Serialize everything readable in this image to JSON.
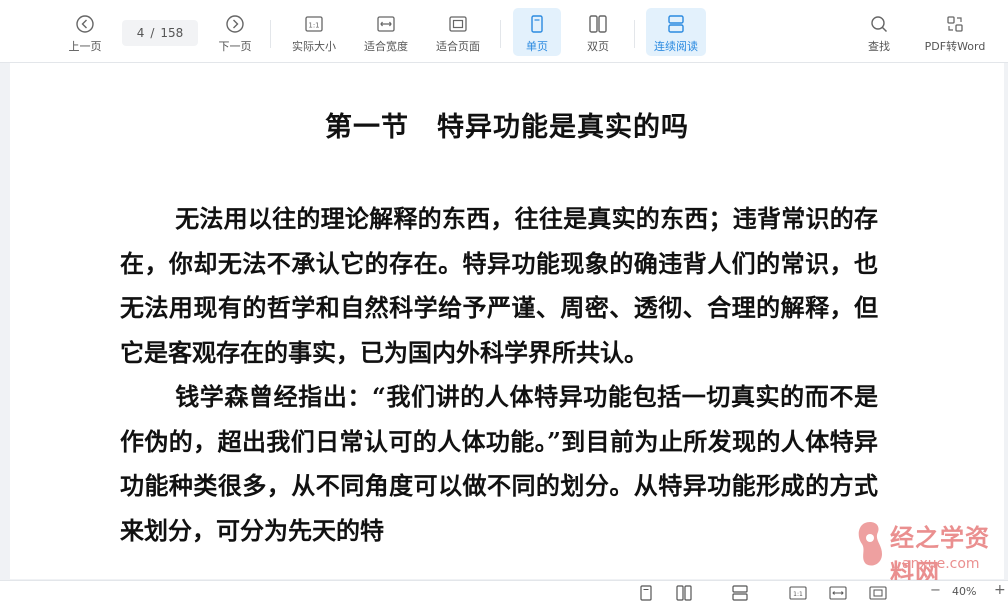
{
  "toolbar": {
    "prev": "上一页",
    "next": "下一页",
    "current_page": "4",
    "page_sep": "/",
    "total_pages": "158",
    "actual_size": "实际大小",
    "fit_width": "适合宽度",
    "fit_page": "适合页面",
    "single_page": "单页",
    "double_page": "双页",
    "continuous": "连续阅读",
    "search": "查找",
    "pdf_to_word": "PDF转Word"
  },
  "document": {
    "title": "第一节　特异功能是真实的吗",
    "paragraphs": [
      "无法用以往的理论解释的东西，往往是真实的东西；违背常识的存在，你却无法不承认它的存在。特异功能现象的确违背人们的常识，也无法用现有的哲学和自然科学给予严谨、周密、透彻、合理的解释，但它是客观存在的事实，已为国内外科学界所共认。",
      "钱学森曾经指出：“我们讲的人体特异功能包括一切真实的而不是作伪的，超出我们日常认可的人体功能。”到目前为止所发现的人体特异功能种类很多，从不同角度可以做不同的划分。从特异功能形成的方式来划分，可分为先天的特"
    ]
  },
  "watermark": {
    "brand": "经之学资料网",
    "url": "anxue.com"
  },
  "statusbar": {
    "zoom": "40%",
    "minus": "−",
    "plus": "+"
  },
  "colors": {
    "accent": "#2b8ae0",
    "active_bg": "#e3f1fc",
    "watermark": "#e46a6a"
  }
}
